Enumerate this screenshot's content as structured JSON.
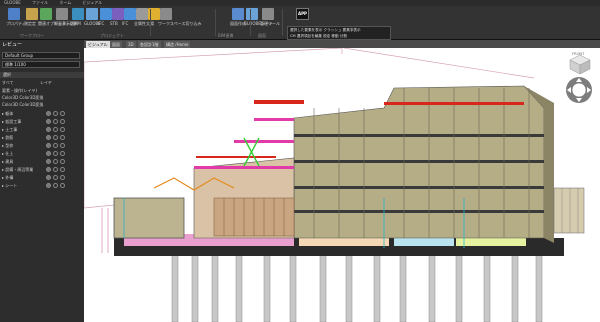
{
  "titlebar": {
    "tabs": [
      "GLOOBE",
      "ファイル",
      "ホーム",
      "ビジュアル"
    ],
    "app_title": ""
  },
  "ribbon": {
    "buttons": [
      {
        "label": "プロパティ",
        "color": "#4e7fc9"
      },
      {
        "label": "測定定",
        "color": "#c9a24e"
      },
      {
        "label": "関連オブジェクト選択",
        "color": "#5aa65a"
      },
      {
        "label": "断面表示",
        "color": "#8a8a8a"
      },
      {
        "label": "L-BIM",
        "color": "#3a8fbf"
      },
      {
        "label": "GLOOBE",
        "color": "#6aa3d8"
      },
      {
        "label": "IFC",
        "color": "#4a90d9"
      },
      {
        "label": "STB",
        "color": "#7b5fbf"
      },
      {
        "label": "IFC",
        "color": "#4a90d9"
      },
      {
        "label": "全属性",
        "color": "#9a9a9a"
      },
      {
        "label": "太陽",
        "color": "#e0b030"
      },
      {
        "label": "ワークスペース切り込み",
        "color": "#8a8a8a"
      },
      {
        "label": "図面作成",
        "color": "#5a8ad0"
      },
      {
        "label": "GLOOBEシート",
        "color": "#6aa3d8"
      },
      {
        "label": "管理ツール",
        "color": "#8a8a8a"
      }
    ],
    "groups": [
      "プロジェクト",
      "BIM連携",
      "図面"
    ],
    "app_badge": "APP",
    "group_titles": {
      "left": "ワークフロー",
      "middle": "プロジェクト",
      "bim": "BIM連携",
      "drawing": "図面"
    },
    "flyout_lines": [
      "選択した要素を表示",
      "クラッシュ",
      "要素非表示",
      "CM",
      "選択項目を編集",
      "設定 移動 分割"
    ]
  },
  "left_panel": {
    "view_label": "レビュー",
    "combo1": "Default Group",
    "combo2": "標準 1/100",
    "section_title": "選択",
    "filter_label": "すべて",
    "layer_label": "レイヤ",
    "header_row": "要素・操作(レイヤ)",
    "list_row1": "Color3D Color3D変換",
    "list_row2": "Color3D Color3D変換",
    "tree": [
      "▸ 躯体",
      "▸ 仮設工事",
      "▸ 土工事",
      "▸ 鉄筋",
      "▸ 型枠",
      "▸ 仕上",
      "▸ 建具",
      "▸ 設備・周辺等業",
      "▸ 外構",
      "▸ シート"
    ]
  },
  "view": {
    "tabs": [
      "ビジュアル",
      "図面",
      "3D",
      "各設計1階",
      "構造 /Home"
    ],
    "cube_label": "FRONT"
  }
}
